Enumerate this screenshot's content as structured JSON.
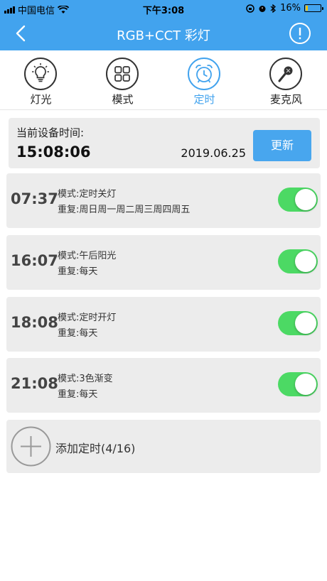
{
  "status_bar": {
    "carrier": "中国电信",
    "time": "下午3:08",
    "battery": "16%",
    "battery_level": 0.16
  },
  "nav": {
    "title": "RGB+CCT 彩灯"
  },
  "tabs": [
    {
      "label": "灯光",
      "icon": "bulb-icon",
      "active": false
    },
    {
      "label": "模式",
      "icon": "grid-icon",
      "active": false
    },
    {
      "label": "定时",
      "icon": "alarm-clock-icon",
      "active": true
    },
    {
      "label": "麦克风",
      "icon": "microphone-icon",
      "active": false
    }
  ],
  "device": {
    "label": "当前设备时间:",
    "time": "15:08:06",
    "date": "2019.06.25",
    "update_label": "更新"
  },
  "timers": [
    {
      "time": "07:37",
      "mode": "模式:定时关灯",
      "repeat": "重复:周日周一周二周三周四周五",
      "enabled": true
    },
    {
      "time": "16:07",
      "mode": "模式:午后阳光",
      "repeat": "重复:每天",
      "enabled": true
    },
    {
      "time": "18:08",
      "mode": "模式:定时开灯",
      "repeat": "重复:每天",
      "enabled": true
    },
    {
      "time": "21:08",
      "mode": "模式:3色渐变",
      "repeat": "重复:每天",
      "enabled": true
    }
  ],
  "add_timer": {
    "label": "添加定时(4/16)"
  },
  "colors": {
    "accent": "#42a3ee",
    "toggle_on": "#4cd964",
    "card_bg": "#ececec"
  }
}
